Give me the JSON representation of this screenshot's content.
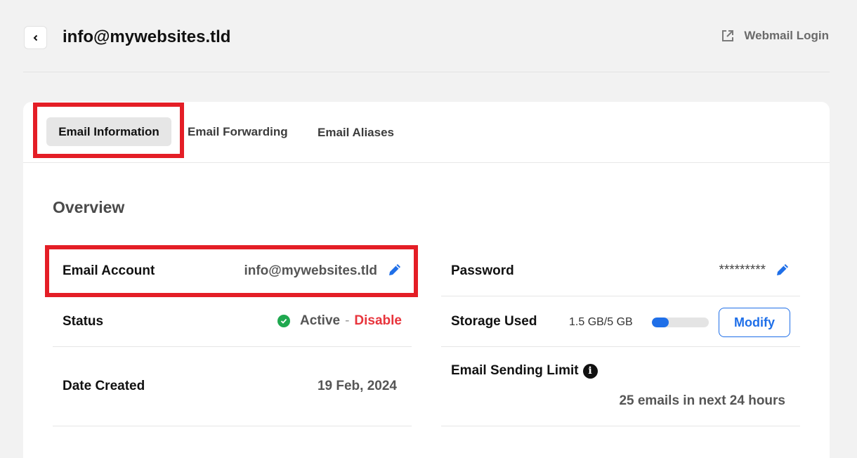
{
  "header": {
    "title": "info@mywebsites.tld",
    "back_icon": "chevron-left-icon",
    "webmail_label": "Webmail Login",
    "webmail_icon": "external-link-icon"
  },
  "tabs": [
    {
      "label": "Email Information",
      "active": true
    },
    {
      "label": "Email Forwarding",
      "active": false
    },
    {
      "label": "Email Aliases",
      "active": false
    }
  ],
  "overview": {
    "title": "Overview",
    "email_account": {
      "label": "Email Account",
      "value": "info@mywebsites.tld"
    },
    "status": {
      "label": "Status",
      "value": "Active",
      "separator": "-",
      "action": "Disable"
    },
    "date_created": {
      "label": "Date Created",
      "value": "19 Feb, 2024"
    },
    "password": {
      "label": "Password",
      "value": "*********"
    },
    "storage": {
      "label": "Storage Used",
      "value": "1.5 GB/5 GB",
      "fraction": 0.3,
      "button": "Modify"
    },
    "sending_limit": {
      "label": "Email Sending Limit",
      "value": "25 emails in next 24 hours"
    }
  },
  "colors": {
    "accent": "#1f6fe8",
    "highlight": "#e41e26",
    "status_active": "#1fa84f",
    "disable": "#e8343c",
    "background": "#f2f2f2"
  }
}
